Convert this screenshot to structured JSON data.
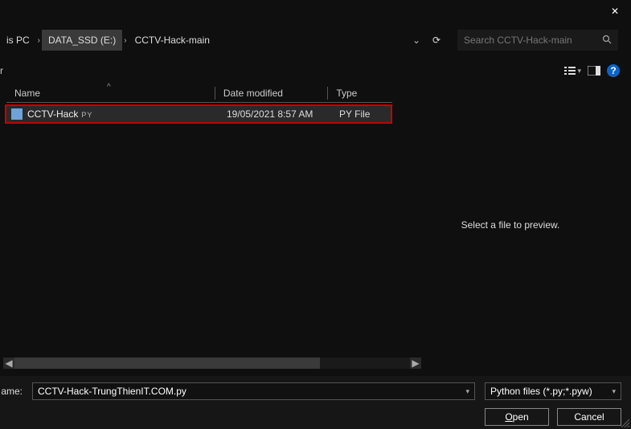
{
  "titlebar": {
    "close_glyph": "✕"
  },
  "breadcrumb": {
    "crumb1": "is PC",
    "crumb2": "DATA_SSD (E:)",
    "crumb3": "CCTV-Hack-main",
    "sep": "›",
    "dropdown": "⌄",
    "refresh": "⟳"
  },
  "search": {
    "placeholder": "Search CCTV-Hack-main",
    "icon": "🔍"
  },
  "toolbar": {
    "left_label": "r",
    "view_caret": "▾",
    "help": "?"
  },
  "columns": {
    "name": "Name",
    "date": "Date modified",
    "type": "Type",
    "sort": "^"
  },
  "files": [
    {
      "name": "CCTV-Hack",
      "ext": "PY",
      "date": "19/05/2021 8:57 AM",
      "type": "PY File"
    }
  ],
  "preview": {
    "msg": "Select a file to preview."
  },
  "scrollbar": {
    "left": "◀",
    "right": "▶"
  },
  "bottom": {
    "filename_label": "ame:",
    "filename_value": "CCTV-Hack-TrungThienIT.COM.py",
    "filetype_label": "Python files (*.py;*.pyw)",
    "open_pre": "O",
    "open_rest": "pen",
    "cancel": "Cancel",
    "dd": "▾"
  }
}
